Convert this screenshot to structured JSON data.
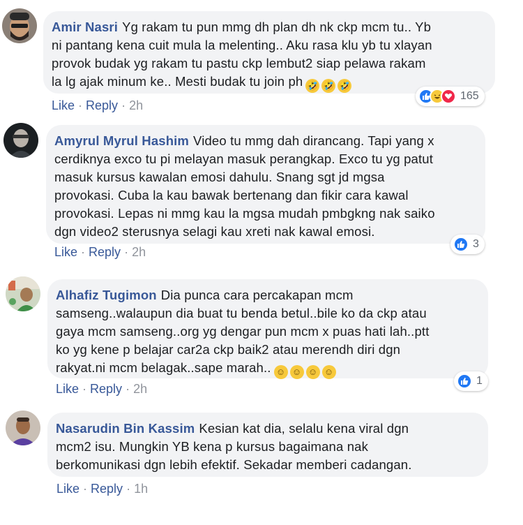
{
  "comments": [
    {
      "author": "Amir Nasri",
      "lines": [
        "Yg rakam tu pun mmg dh plan dh nk ckp mcm tu.. Yb",
        "ni pantang kena cuit mula la melenting.. Aku rasa klu yb tu xlayan",
        "provok budak yg rakam tu pastu ckp lembut2 siap pelawa rakam",
        "la lg ajak minum ke.. Mesti budak tu join ph"
      ],
      "like_label": "Like",
      "reply_label": "Reply",
      "time": "2h",
      "reaction_count": "165",
      "reactions": [
        "like",
        "haha",
        "love"
      ]
    },
    {
      "author": "Amyrul Myrul Hashim",
      "lines": [
        "Video tu mmg dah dirancang. Tapi yang x",
        "cerdiknya exco tu pi melayan masuk perangkap. Exco tu yg patut",
        "masuk kursus kawalan emosi dahulu. Snang sgt jd mgsa",
        "provokasi. Cuba la kau bawak bertenang dan fikir cara kawal",
        "provokasi. Lepas ni mmg kau la mgsa mudah pmbgkng nak saiko",
        "dgn video2 sterusnya selagi kau xreti nak kawal emosi."
      ],
      "like_label": "Like",
      "reply_label": "Reply",
      "time": "2h",
      "reaction_count": "3",
      "reactions": [
        "like"
      ]
    },
    {
      "author": "Alhafiz Tugimon",
      "lines": [
        "Dia punca cara percakapan mcm",
        "samseng..walaupun dia buat tu benda betul..bile ko da ckp atau",
        "gaya mcm samseng..org yg dengar pun mcm x puas hati lah..ptt",
        "ko yg kene p belajar car2a ckp baik2 atau merendh diri dgn",
        "rakyat.ni mcm belagak..sape marah.."
      ],
      "like_label": "Like",
      "reply_label": "Reply",
      "time": "2h",
      "reaction_count": "1",
      "reactions": [
        "like"
      ]
    },
    {
      "author": "Nasarudin Bin Kassim",
      "lines": [
        "Kesian kat dia, selalu kena viral dgn",
        "mcm2 isu. Mungkin YB kena p kursus bagaimana nak",
        "berkomunikasi dgn lebih efektif. Sekadar memberi cadangan."
      ],
      "like_label": "Like",
      "reply_label": "Reply",
      "time": "1h"
    }
  ],
  "emoji": {
    "rofl": "🤣",
    "smile": "☺"
  }
}
